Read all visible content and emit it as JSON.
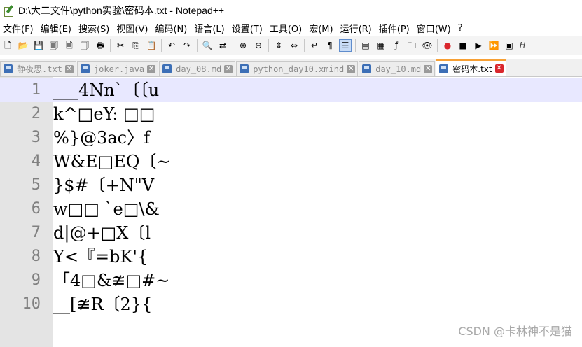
{
  "window": {
    "title": "D:\\大二文件\\python实验\\密码本.txt - Notepad++"
  },
  "menu": {
    "items": [
      "文件(F)",
      "编辑(E)",
      "搜索(S)",
      "视图(V)",
      "编码(N)",
      "语言(L)",
      "设置(T)",
      "工具(O)",
      "宏(M)",
      "运行(R)",
      "插件(P)",
      "窗口(W)",
      "?"
    ]
  },
  "toolbar": {
    "buttons": [
      {
        "icon": "new-file-icon",
        "glyph": "🗋"
      },
      {
        "icon": "open-file-icon",
        "glyph": "📂"
      },
      {
        "icon": "save-icon",
        "glyph": "💾"
      },
      {
        "icon": "save-all-icon",
        "glyph": "🗐"
      },
      {
        "icon": "close-icon",
        "glyph": "🗎"
      },
      {
        "icon": "close-all-icon",
        "glyph": "🗍"
      },
      {
        "icon": "print-icon",
        "glyph": "🖶"
      },
      {
        "icon": "cut-icon",
        "glyph": "✂"
      },
      {
        "icon": "copy-icon",
        "glyph": "⎘"
      },
      {
        "icon": "paste-icon",
        "glyph": "📋"
      },
      {
        "icon": "undo-icon",
        "glyph": "↶"
      },
      {
        "icon": "redo-icon",
        "glyph": "↷"
      },
      {
        "icon": "find-icon",
        "glyph": "🔍"
      },
      {
        "icon": "replace-icon",
        "glyph": "⇄"
      },
      {
        "icon": "zoom-in-icon",
        "glyph": "⊕"
      },
      {
        "icon": "zoom-out-icon",
        "glyph": "⊖"
      },
      {
        "icon": "sync-vertical-icon",
        "glyph": "⇕"
      },
      {
        "icon": "sync-horizontal-icon",
        "glyph": "⇔"
      },
      {
        "icon": "word-wrap-icon",
        "glyph": "↵"
      },
      {
        "icon": "show-all-chars-icon",
        "glyph": "¶"
      },
      {
        "icon": "indent-guide-icon",
        "glyph": "☰",
        "active": true
      },
      {
        "icon": "user-language-icon",
        "glyph": "▤"
      },
      {
        "icon": "document-map-icon",
        "glyph": "▦"
      },
      {
        "icon": "function-list-icon",
        "glyph": "ƒ"
      },
      {
        "icon": "folder-workspace-icon",
        "glyph": "🗀"
      },
      {
        "icon": "monitoring-icon",
        "glyph": "👁"
      },
      {
        "icon": "record-macro-icon",
        "glyph": "●"
      },
      {
        "icon": "stop-macro-icon",
        "glyph": "■"
      },
      {
        "icon": "play-macro-icon",
        "glyph": "▶"
      },
      {
        "icon": "run-macro-multiple-icon",
        "glyph": "⏩"
      },
      {
        "icon": "save-macro-icon",
        "glyph": "▣"
      }
    ],
    "last_label": "H"
  },
  "tabs": [
    {
      "label": "静夜思.txt",
      "active": false
    },
    {
      "label": "joker.java",
      "active": false
    },
    {
      "label": "day_08.md",
      "active": false
    },
    {
      "label": "python_day10.xmind",
      "active": false
    },
    {
      "label": "day_10.md",
      "active": false
    },
    {
      "label": "密码本.txt",
      "active": true
    }
  ],
  "colors": {
    "current_line": "#e8e8ff",
    "active_tab_accent": "#f7a035",
    "tab_close_active": "#d9262c"
  },
  "editor": {
    "lines": [
      {
        "number": "1",
        "text": "___4Nn`〔〔u"
      },
      {
        "number": "2",
        "text": "k^□eY: □□"
      },
      {
        "number": "3",
        "text": "%}@3ac〉f"
      },
      {
        "number": "4",
        "text": "W&E□EQ〔~"
      },
      {
        "number": "5",
        "text": "}$#〔+N\"V"
      },
      {
        "number": "6",
        "text": "w□□ `e□\\&"
      },
      {
        "number": "7",
        "text": "d|@+□X〔l"
      },
      {
        "number": "8",
        "text": "Y<『=bK'{"
      },
      {
        "number": "9",
        "text": "「4□&≇□#~"
      },
      {
        "number": "10",
        "text": "__[≇R〔2}{"
      }
    ]
  },
  "watermark": "CSDN @卡林神不是猫"
}
